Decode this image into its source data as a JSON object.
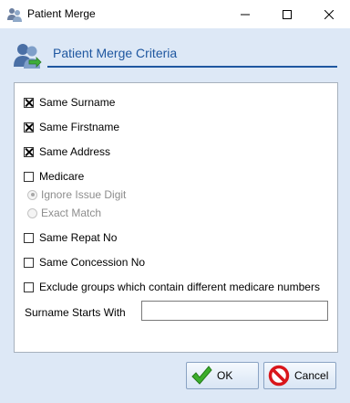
{
  "window": {
    "title": "Patient Merge",
    "minimize_label": "minimize",
    "maximize_label": "maximize",
    "close_label": "close"
  },
  "header": {
    "title": "Patient Merge Criteria",
    "icon": "users-merge-icon"
  },
  "criteria": {
    "same_surname": {
      "label": "Same Surname",
      "checked": true
    },
    "same_firstname": {
      "label": "Same Firstname",
      "checked": true
    },
    "same_address": {
      "label": "Same Address",
      "checked": true
    },
    "medicare": {
      "label": "Medicare",
      "checked": false
    },
    "medicare_options": [
      {
        "label": "Ignore Issue Digit",
        "selected": true,
        "enabled": false
      },
      {
        "label": "Exact Match",
        "selected": false,
        "enabled": false
      }
    ],
    "same_repat_no": {
      "label": "Same Repat No",
      "checked": false
    },
    "same_concession_no": {
      "label": "Same Concession No",
      "checked": false
    },
    "exclude_groups": {
      "label": "Exclude groups which contain different medicare numbers",
      "checked": false
    },
    "surname_starts_with": {
      "label": "Surname Starts With",
      "value": ""
    }
  },
  "buttons": {
    "ok_label": "OK",
    "cancel_label": "Cancel"
  },
  "colors": {
    "accent": "#1f57a0",
    "background": "#dde8f6"
  }
}
